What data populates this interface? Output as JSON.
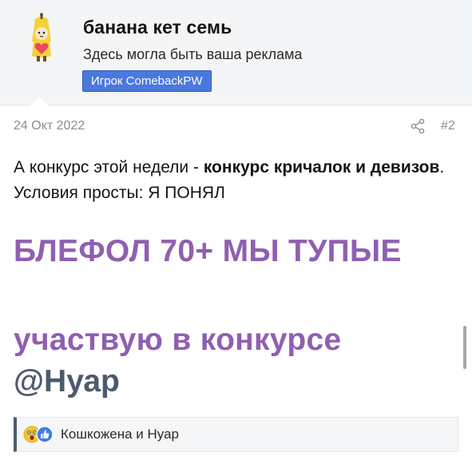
{
  "author": {
    "name": "банана кет семь",
    "title": "Здесь могла быть ваша реклама",
    "banner": "Игрок ComebackPW"
  },
  "post": {
    "date": "24 Окт 2022",
    "number": "#2",
    "intro_plain_1": "А конкурс этой недели - ",
    "intro_bold": "конкурс кричалок и девизов",
    "intro_plain_2": ". Условия просты: Я ПОНЯЛ",
    "big_line_1": "БЛЕФОЛ 70+ МЫ ТУПЫЕ",
    "big_line_2": "участвую в конкурсе",
    "mention": "@Нуар"
  },
  "reactions": {
    "icons": [
      "astonished-emoji-icon",
      "like-thumb-icon"
    ],
    "users_text": "Кошкожена и Нуар"
  },
  "colors": {
    "accent_purple": "#8f5fb0",
    "mention": "#4d5a6e",
    "banner": "#4a78de"
  }
}
